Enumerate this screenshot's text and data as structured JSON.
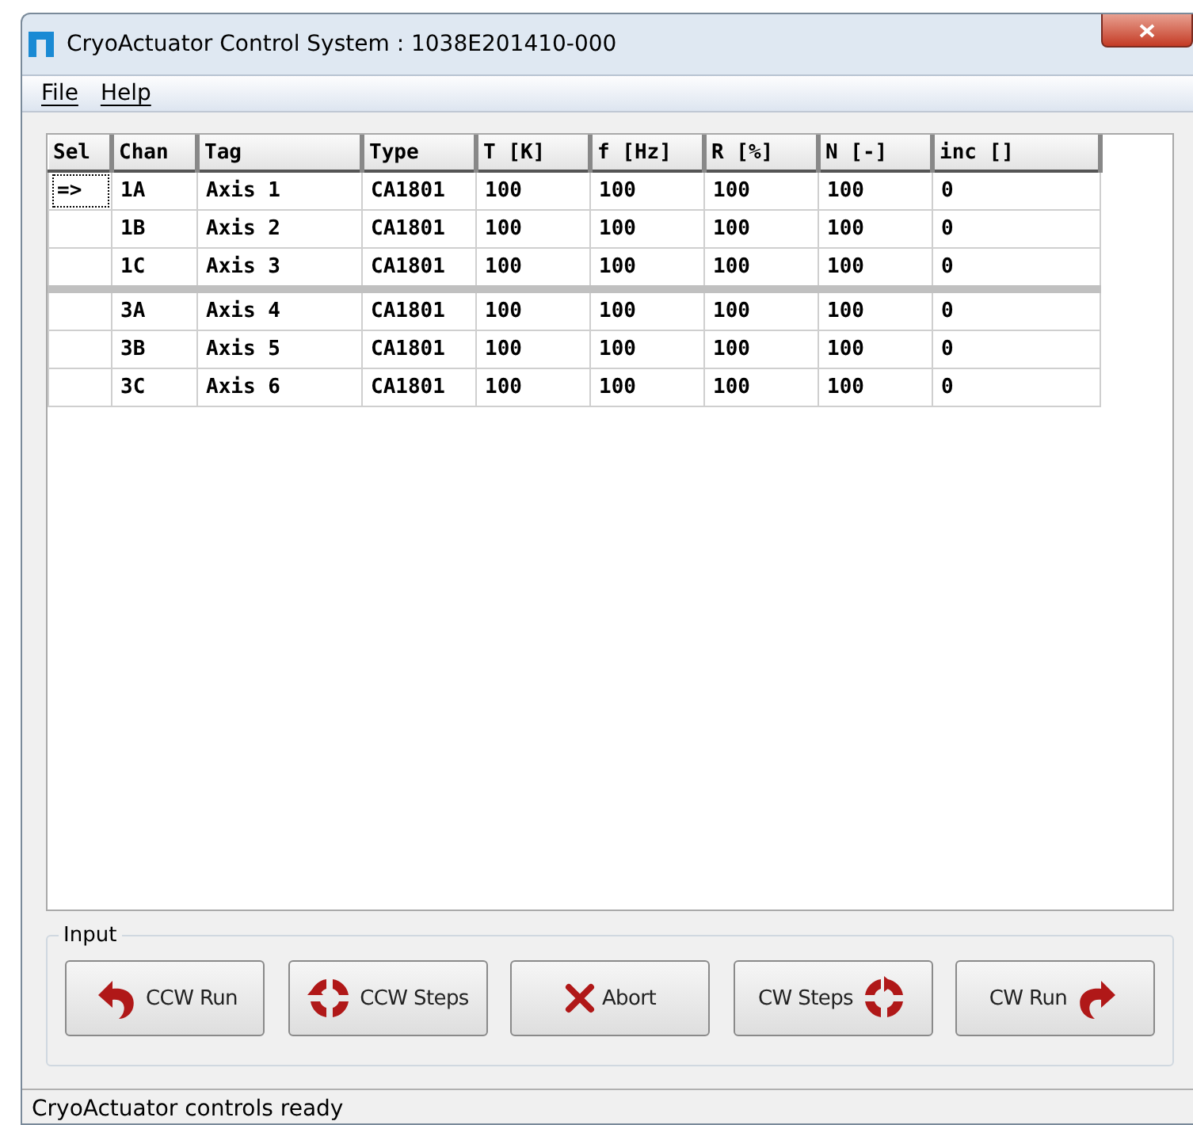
{
  "window": {
    "title": "CryoActuator Control System : 1038E201410-000"
  },
  "menu": [
    {
      "label": "File"
    },
    {
      "label": "Help"
    }
  ],
  "table": {
    "columns": [
      "Sel",
      "Chan",
      "Tag",
      "Type",
      "T [K]",
      "f [Hz]",
      "R [%]",
      "N [-]",
      "inc []"
    ],
    "rows": [
      {
        "current": true,
        "separator_before": false,
        "cells": [
          "=>",
          "1A",
          "Axis 1",
          "CA1801",
          "100",
          "100",
          "100",
          "100",
          "0"
        ]
      },
      {
        "current": false,
        "separator_before": false,
        "cells": [
          "",
          "1B",
          "Axis 2",
          "CA1801",
          "100",
          "100",
          "100",
          "100",
          "0"
        ]
      },
      {
        "current": false,
        "separator_before": false,
        "cells": [
          "",
          "1C",
          "Axis 3",
          "CA1801",
          "100",
          "100",
          "100",
          "100",
          "0"
        ]
      },
      {
        "current": false,
        "separator_before": true,
        "cells": [
          "",
          "3A",
          "Axis 4",
          "CA1801",
          "100",
          "100",
          "100",
          "100",
          "0"
        ]
      },
      {
        "current": false,
        "separator_before": false,
        "cells": [
          "",
          "3B",
          "Axis 5",
          "CA1801",
          "100",
          "100",
          "100",
          "100",
          "0"
        ]
      },
      {
        "current": false,
        "separator_before": false,
        "cells": [
          "",
          "3C",
          "Axis 6",
          "CA1801",
          "100",
          "100",
          "100",
          "100",
          "0"
        ]
      }
    ]
  },
  "input": {
    "title": "Input",
    "buttons": [
      {
        "label": "CCW Run",
        "kind": "ccw-run"
      },
      {
        "label": "CCW Steps",
        "kind": "ccw-steps"
      },
      {
        "label": "Abort",
        "kind": "abort"
      },
      {
        "label": "CW Steps",
        "kind": "cw-steps"
      },
      {
        "label": "CW Run",
        "kind": "cw-run"
      }
    ]
  },
  "status_bar": "CryoActuator controls ready"
}
